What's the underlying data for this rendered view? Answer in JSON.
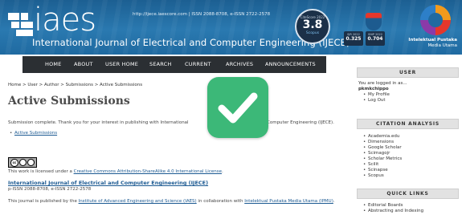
{
  "header": {
    "logo_text": "iaes",
    "issn_line": "http://ijece.iaescore.com | ISSN 2088-8708, e-ISSN 2722-2578",
    "journal_title": "International Journal of Electrical and Computer Engineering (IJECE)",
    "score_value": "3.8",
    "score_top": "CiteScore 2022",
    "score_bottom": "Scopus",
    "metric_a_label": "SJR 2022",
    "metric_a_value": "0.325",
    "metric_b_label": "SNIP 2022",
    "metric_b_value": "0.704",
    "publisher_name_bold": "Intelektual Pustaka",
    "publisher_name_sub": "Media Utama"
  },
  "nav": {
    "items": [
      {
        "label": "HOME"
      },
      {
        "label": "ABOUT"
      },
      {
        "label": "USER HOME"
      },
      {
        "label": "SEARCH"
      },
      {
        "label": "CURRENT"
      },
      {
        "label": "ARCHIVES"
      },
      {
        "label": "ANNOUNCEMENTS"
      }
    ]
  },
  "main": {
    "breadcrumb": "Home > User > Author > Submissions > Active Submissions",
    "title": "Active Submissions",
    "message": "Submission complete. Thank you for your interest in publishing with International",
    "message_tail": "Computer Engineering (IJECE).",
    "link": "Active Submissions",
    "cc_text": "cc",
    "license_prefix": "This work is licensed under a ",
    "license_link": "Creative Commons Attribution-ShareAlike 4.0 International License",
    "license_suffix": ".",
    "footer_journal": "International Journal of Electrical and Computer Engineering (IJECE)",
    "footer_issn": "p-ISSN 2088-8708, e-ISSN 2722-2578",
    "publisher_prefix": "This journal is published by the ",
    "publisher_link1": "Institute of Advanced Engineering and Science (IAES)",
    "publisher_middle": " in collaboration with ",
    "publisher_link2": "Intelektual Pustaka Media Utama (IPMU)",
    "publisher_suffix": "."
  },
  "sidebar": {
    "user_title": "USER",
    "logged_in": "You are logged in as...",
    "username": "pkmkchippo",
    "user_links": [
      "My Profile",
      "Log Out"
    ],
    "citation_title": "CITATION ANALYSIS",
    "citation_links": [
      "Academia.edu",
      "Dimensions",
      "Google Scholar",
      "Scimagojr",
      "Scholar Metrics",
      "Scilit",
      "Scinapse",
      "Scopus"
    ],
    "quick_title": "QUICK LINKS",
    "quick_links": [
      "Editorial Boards",
      "Abstracting and Indexing"
    ]
  },
  "colors": {
    "header_blue": "#2a79b0",
    "nav_dark": "#2b2f33",
    "link_blue": "#1c5a92",
    "check_green": "#3cb878"
  },
  "icons": {
    "overlay": "check-icon",
    "license": "creative-commons-icon"
  }
}
